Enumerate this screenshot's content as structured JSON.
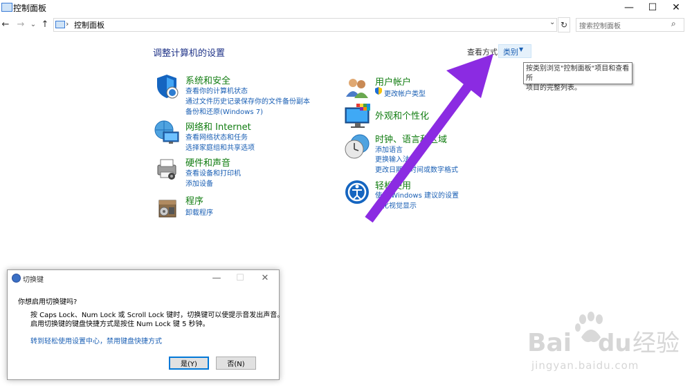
{
  "window": {
    "title": "控制面板",
    "buttons": {
      "minimize": "—",
      "maximize": "☐",
      "close": "✕"
    }
  },
  "nav": {
    "back": "←",
    "forward": "→",
    "dropdown": "⌄",
    "up": "↑",
    "address_separator": "›",
    "address": "控制面板",
    "address_dropdown": "⌄",
    "refresh": "↻",
    "search_placeholder": "搜索控制面板",
    "search_glyph": "⌕"
  },
  "content": {
    "heading": "调整计算机的设置",
    "view_by_label": "查看方式:",
    "view_by_value": "类别",
    "view_by_caret": "▼",
    "tooltip_line1": "按类别浏览\"控制面板\"项目和查看所",
    "tooltip_line2": "项目的完整列表。",
    "categories_left": [
      {
        "icon": "system-security-icon",
        "title": "系统和安全",
        "links": [
          "查看你的计算机状态",
          "通过文件历史记录保存你的文件备份副本",
          "备份和还原(Windows 7)"
        ]
      },
      {
        "icon": "network-internet-icon",
        "title": "网络和 Internet",
        "links": [
          "查看网络状态和任务",
          "选择家庭组和共享选项"
        ]
      },
      {
        "icon": "hardware-sound-icon",
        "title": "硬件和声音",
        "links": [
          "查看设备和打印机",
          "添加设备"
        ]
      },
      {
        "icon": "programs-icon",
        "title": "程序",
        "links": [
          "卸载程序"
        ]
      }
    ],
    "categories_right": [
      {
        "icon": "user-accounts-icon",
        "title": "用户帐户",
        "links": [
          "更改帐户类型"
        ]
      },
      {
        "icon": "appearance-icon",
        "title": "外观和个性化",
        "links": []
      },
      {
        "icon": "clock-region-icon",
        "title": "时钟、语言和区域",
        "links": [
          "添加语言",
          "更换输入法",
          "更改日期、时间或数字格式"
        ]
      },
      {
        "icon": "ease-of-access-icon",
        "title": "轻松使用",
        "links": [
          "使用 Windows 建议的设置",
          "优化视觉显示"
        ]
      }
    ],
    "arrow_color": "#8b2be2"
  },
  "dialog": {
    "title": "切换键",
    "buttons": {
      "minimize": "—",
      "maximize": "☐",
      "close": "✕"
    },
    "question": "你想启用切换键吗?",
    "line1": "按 Caps Lock、Num Lock 或 Scroll Lock 键时，切换键可以使提示音发出声音。",
    "line2": "启用切换键的键盘快捷方式是按住 Num Lock 键 5 秒钟。",
    "link": "转到轻松使用设置中心，禁用键盘快捷方式",
    "yes": "是(Y)",
    "no": "否(N)"
  },
  "watermark": {
    "brand": "Bai",
    "brand2": "du",
    "brand3": "经验",
    "url": "jingyan.baidu.com"
  }
}
